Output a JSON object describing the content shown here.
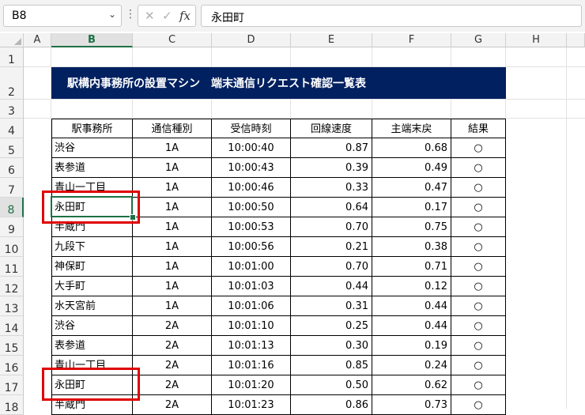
{
  "formula_bar": {
    "name_box": "B8",
    "name_box_dropdown": "⌄",
    "more_icon": "⋮",
    "cancel_icon": "✕",
    "enter_icon": "✓",
    "fx_label": "fx",
    "formula_value": "永田町"
  },
  "columns": [
    "A",
    "B",
    "C",
    "D",
    "E",
    "F",
    "G",
    "H"
  ],
  "selected_column": "B",
  "rows": [
    "1",
    "2",
    "3",
    "4",
    "5",
    "6",
    "7",
    "8",
    "9",
    "10",
    "11",
    "12",
    "13",
    "14",
    "15",
    "16",
    "17",
    "18"
  ],
  "selected_row": "8",
  "sheet": {
    "title": "駅構内事務所の設置マシン　端末通信リクエスト確認一覧表",
    "title_bg": "#002060",
    "headers": [
      "駅事務所",
      "通信種別",
      "受信時刻",
      "回線速度",
      "主端末戻",
      "結果"
    ],
    "records": [
      [
        "渋谷",
        "1A",
        "10:00:40",
        "0.87",
        "0.68",
        "○"
      ],
      [
        "表参道",
        "1A",
        "10:00:43",
        "0.39",
        "0.49",
        "○"
      ],
      [
        "青山一丁目",
        "1A",
        "10:00:46",
        "0.33",
        "0.47",
        "○"
      ],
      [
        "永田町",
        "1A",
        "10:00:50",
        "0.64",
        "0.17",
        "○"
      ],
      [
        "半蔵門",
        "1A",
        "10:00:53",
        "0.70",
        "0.75",
        "○"
      ],
      [
        "九段下",
        "1A",
        "10:00:56",
        "0.21",
        "0.38",
        "○"
      ],
      [
        "神保町",
        "1A",
        "10:01:00",
        "0.70",
        "0.71",
        "○"
      ],
      [
        "大手町",
        "1A",
        "10:01:03",
        "0.44",
        "0.12",
        "○"
      ],
      [
        "水天宮前",
        "1A",
        "10:01:06",
        "0.31",
        "0.44",
        "○"
      ],
      [
        "渋谷",
        "2A",
        "10:01:10",
        "0.25",
        "0.44",
        "○"
      ],
      [
        "表参道",
        "2A",
        "10:01:13",
        "0.30",
        "0.19",
        "○"
      ],
      [
        "青山一丁目",
        "2A",
        "10:01:16",
        "0.85",
        "0.24",
        "○"
      ],
      [
        "永田町",
        "2A",
        "10:01:20",
        "0.50",
        "0.62",
        "○"
      ],
      [
        "半蔵門",
        "2A",
        "10:01:23",
        "0.86",
        "0.73",
        "○"
      ]
    ]
  },
  "colors": {
    "selection_green": "#1e7145",
    "highlight_red": "#e00000"
  }
}
